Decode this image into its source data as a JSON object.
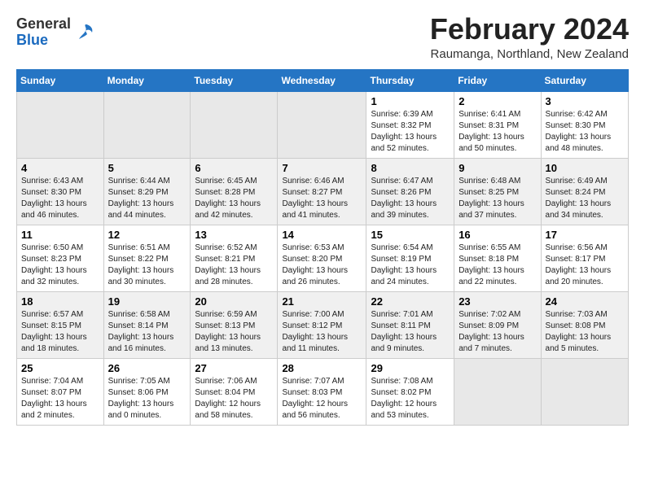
{
  "header": {
    "logo_general": "General",
    "logo_blue": "Blue",
    "main_title": "February 2024",
    "subtitle": "Raumanga, Northland, New Zealand"
  },
  "days_of_week": [
    "Sunday",
    "Monday",
    "Tuesday",
    "Wednesday",
    "Thursday",
    "Friday",
    "Saturday"
  ],
  "weeks": [
    [
      {
        "day": "",
        "empty": true
      },
      {
        "day": "",
        "empty": true
      },
      {
        "day": "",
        "empty": true
      },
      {
        "day": "",
        "empty": true
      },
      {
        "day": "1",
        "sunrise": "6:39 AM",
        "sunset": "8:32 PM",
        "daylight": "13 hours and 52 minutes."
      },
      {
        "day": "2",
        "sunrise": "6:41 AM",
        "sunset": "8:31 PM",
        "daylight": "13 hours and 50 minutes."
      },
      {
        "day": "3",
        "sunrise": "6:42 AM",
        "sunset": "8:30 PM",
        "daylight": "13 hours and 48 minutes."
      }
    ],
    [
      {
        "day": "4",
        "sunrise": "6:43 AM",
        "sunset": "8:30 PM",
        "daylight": "13 hours and 46 minutes."
      },
      {
        "day": "5",
        "sunrise": "6:44 AM",
        "sunset": "8:29 PM",
        "daylight": "13 hours and 44 minutes."
      },
      {
        "day": "6",
        "sunrise": "6:45 AM",
        "sunset": "8:28 PM",
        "daylight": "13 hours and 42 minutes."
      },
      {
        "day": "7",
        "sunrise": "6:46 AM",
        "sunset": "8:27 PM",
        "daylight": "13 hours and 41 minutes."
      },
      {
        "day": "8",
        "sunrise": "6:47 AM",
        "sunset": "8:26 PM",
        "daylight": "13 hours and 39 minutes."
      },
      {
        "day": "9",
        "sunrise": "6:48 AM",
        "sunset": "8:25 PM",
        "daylight": "13 hours and 37 minutes."
      },
      {
        "day": "10",
        "sunrise": "6:49 AM",
        "sunset": "8:24 PM",
        "daylight": "13 hours and 34 minutes."
      }
    ],
    [
      {
        "day": "11",
        "sunrise": "6:50 AM",
        "sunset": "8:23 PM",
        "daylight": "13 hours and 32 minutes."
      },
      {
        "day": "12",
        "sunrise": "6:51 AM",
        "sunset": "8:22 PM",
        "daylight": "13 hours and 30 minutes."
      },
      {
        "day": "13",
        "sunrise": "6:52 AM",
        "sunset": "8:21 PM",
        "daylight": "13 hours and 28 minutes."
      },
      {
        "day": "14",
        "sunrise": "6:53 AM",
        "sunset": "8:20 PM",
        "daylight": "13 hours and 26 minutes."
      },
      {
        "day": "15",
        "sunrise": "6:54 AM",
        "sunset": "8:19 PM",
        "daylight": "13 hours and 24 minutes."
      },
      {
        "day": "16",
        "sunrise": "6:55 AM",
        "sunset": "8:18 PM",
        "daylight": "13 hours and 22 minutes."
      },
      {
        "day": "17",
        "sunrise": "6:56 AM",
        "sunset": "8:17 PM",
        "daylight": "13 hours and 20 minutes."
      }
    ],
    [
      {
        "day": "18",
        "sunrise": "6:57 AM",
        "sunset": "8:15 PM",
        "daylight": "13 hours and 18 minutes."
      },
      {
        "day": "19",
        "sunrise": "6:58 AM",
        "sunset": "8:14 PM",
        "daylight": "13 hours and 16 minutes."
      },
      {
        "day": "20",
        "sunrise": "6:59 AM",
        "sunset": "8:13 PM",
        "daylight": "13 hours and 13 minutes."
      },
      {
        "day": "21",
        "sunrise": "7:00 AM",
        "sunset": "8:12 PM",
        "daylight": "13 hours and 11 minutes."
      },
      {
        "day": "22",
        "sunrise": "7:01 AM",
        "sunset": "8:11 PM",
        "daylight": "13 hours and 9 minutes."
      },
      {
        "day": "23",
        "sunrise": "7:02 AM",
        "sunset": "8:09 PM",
        "daylight": "13 hours and 7 minutes."
      },
      {
        "day": "24",
        "sunrise": "7:03 AM",
        "sunset": "8:08 PM",
        "daylight": "13 hours and 5 minutes."
      }
    ],
    [
      {
        "day": "25",
        "sunrise": "7:04 AM",
        "sunset": "8:07 PM",
        "daylight": "13 hours and 2 minutes."
      },
      {
        "day": "26",
        "sunrise": "7:05 AM",
        "sunset": "8:06 PM",
        "daylight": "13 hours and 0 minutes."
      },
      {
        "day": "27",
        "sunrise": "7:06 AM",
        "sunset": "8:04 PM",
        "daylight": "12 hours and 58 minutes."
      },
      {
        "day": "28",
        "sunrise": "7:07 AM",
        "sunset": "8:03 PM",
        "daylight": "12 hours and 56 minutes."
      },
      {
        "day": "29",
        "sunrise": "7:08 AM",
        "sunset": "8:02 PM",
        "daylight": "12 hours and 53 minutes."
      },
      {
        "day": "",
        "empty": true
      },
      {
        "day": "",
        "empty": true
      }
    ]
  ]
}
